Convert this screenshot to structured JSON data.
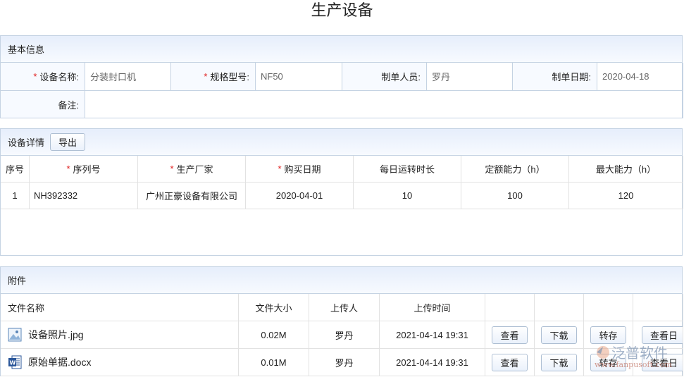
{
  "title": "生产设备",
  "basic": {
    "header": "基本信息",
    "fields": [
      {
        "label": "设备名称:",
        "value": "分装封口机",
        "required": true
      },
      {
        "label": "规格型号:",
        "value": "NF50",
        "required": true
      },
      {
        "label": "制单人员:",
        "value": "罗丹",
        "required": false
      },
      {
        "label": "制单日期:",
        "value": "2020-04-18",
        "required": false
      }
    ],
    "remark_label": "备注:",
    "remark_value": ""
  },
  "detail": {
    "header": "设备详情",
    "export_label": "导出",
    "columns": [
      {
        "label": "序号",
        "required": false
      },
      {
        "label": "序列号",
        "required": true
      },
      {
        "label": "生产厂家",
        "required": true
      },
      {
        "label": "购买日期",
        "required": true
      },
      {
        "label": "每日运转时长",
        "required": false
      },
      {
        "label": "定额能力（h）",
        "required": false
      },
      {
        "label": "最大能力（h）",
        "required": false
      }
    ],
    "rows": [
      [
        "1",
        "NH392332",
        "广州正豪设备有限公司",
        "2020-04-01",
        "10",
        "100",
        "120"
      ]
    ]
  },
  "attach": {
    "header": "附件",
    "columns": [
      "文件名称",
      "文件大小",
      "上传人",
      "上传时间"
    ],
    "rows": [
      {
        "icon": "image-file-icon",
        "name": "设备照片.jpg",
        "size": "0.02M",
        "uploader": "罗丹",
        "time": "2021-04-14 19:31"
      },
      {
        "icon": "word-file-icon",
        "name": "原始单据.docx",
        "size": "0.01M",
        "uploader": "罗丹",
        "time": "2021-04-14 19:31"
      }
    ],
    "actions": [
      "查看",
      "下载",
      "转存",
      "查看日"
    ]
  },
  "watermark": {
    "brand": "泛普软件",
    "url": "www.fanpusoft.com"
  }
}
